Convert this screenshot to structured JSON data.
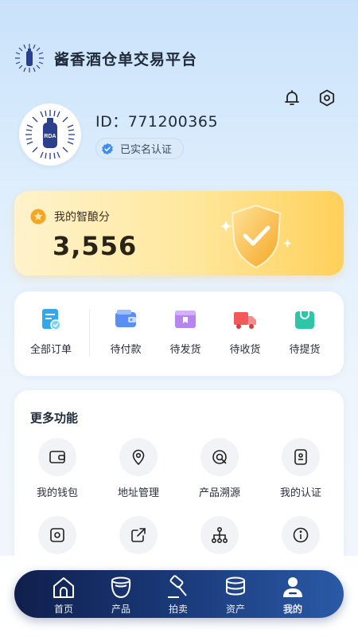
{
  "app": {
    "title": "酱香酒仓单交易平台",
    "logo_text": "RDA"
  },
  "header_icons": [
    "bell-icon",
    "settings-icon"
  ],
  "profile": {
    "id_text": "ID：771200365",
    "verify_text": "已实名认证"
  },
  "score": {
    "label": "我的智酿分",
    "value": "3,556"
  },
  "orders": {
    "all_label": "全部订单",
    "items": [
      {
        "label": "待付款",
        "icon": "wallet-icon"
      },
      {
        "label": "待发货",
        "icon": "box-icon"
      },
      {
        "label": "待收货",
        "icon": "truck-icon"
      },
      {
        "label": "待提货",
        "icon": "bag-icon"
      }
    ]
  },
  "more": {
    "title": "更多功能",
    "items": [
      {
        "label": "我的钱包",
        "icon": "wallet-outline-icon"
      },
      {
        "label": "地址管理",
        "icon": "location-pin-icon"
      },
      {
        "label": "产品溯源",
        "icon": "trace-icon"
      },
      {
        "label": "我的认证",
        "icon": "id-card-icon"
      },
      {
        "label": "",
        "icon": "camera-square-icon"
      },
      {
        "label": "",
        "icon": "share-link-icon"
      },
      {
        "label": "",
        "icon": "org-tree-icon"
      },
      {
        "label": "",
        "icon": "info-icon"
      }
    ]
  },
  "tabbar": {
    "items": [
      {
        "label": "首页",
        "icon": "home-icon"
      },
      {
        "label": "产品",
        "icon": "product-jar-icon"
      },
      {
        "label": "拍卖",
        "icon": "auction-hammer-icon"
      },
      {
        "label": "资产",
        "icon": "assets-stack-icon"
      },
      {
        "label": "我的",
        "icon": "user-icon"
      }
    ],
    "active": "我的"
  },
  "colors": {
    "accent": "#1a3a7a",
    "score_gold": "#ffd05a",
    "verify_blue": "#3b8ef0"
  }
}
